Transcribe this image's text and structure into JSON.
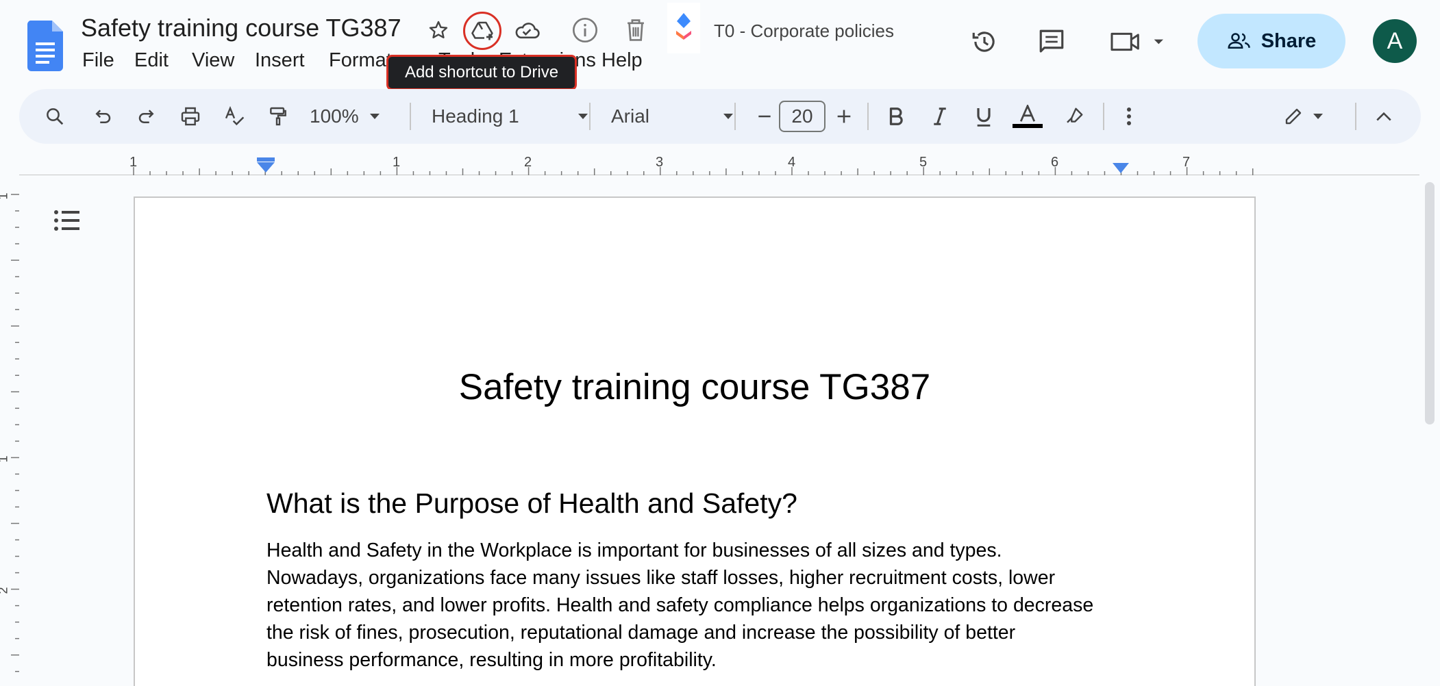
{
  "header": {
    "doc_title": "Safety training course TG387",
    "folder_label": "T0 - Corporate policies",
    "share_label": "Share",
    "avatar_letter": "A",
    "tooltip": "Add shortcut to Drive"
  },
  "menu": {
    "file": "File",
    "edit": "Edit",
    "view": "View",
    "insert": "Insert",
    "format": "Format",
    "tools": "Tools",
    "extensions": "Extensions",
    "help": "Help"
  },
  "toolbar": {
    "zoom": "100%",
    "style": "Heading 1",
    "font": "Arial",
    "font_size": "20"
  },
  "ruler": {
    "numbers": [
      "1",
      "1",
      "2",
      "3",
      "4",
      "5",
      "6",
      "7"
    ],
    "vertical_numbers": [
      "1",
      "1",
      "2"
    ]
  },
  "document": {
    "title": "Safety training course TG387",
    "heading": "What is the Purpose of Health and Safety?",
    "body_lines": [
      "Health and Safety in the Workplace is important for businesses of all sizes and types.",
      "Nowadays, organizations face many issues like staff losses, higher recruitment costs, lower",
      "retention rates, and lower profits. Health and safety compliance helps organizations to decrease",
      "the risk of fines, prosecution, reputational damage and increase the possibility of better",
      "business performance, resulting in more profitability."
    ]
  },
  "colors": {
    "accent": "#0b57d0",
    "share_bg": "#c2e7ff",
    "avatar_bg": "#0e5a4a",
    "highlight_ring": "#d93025",
    "toolbar_bg": "#edf2fa"
  }
}
